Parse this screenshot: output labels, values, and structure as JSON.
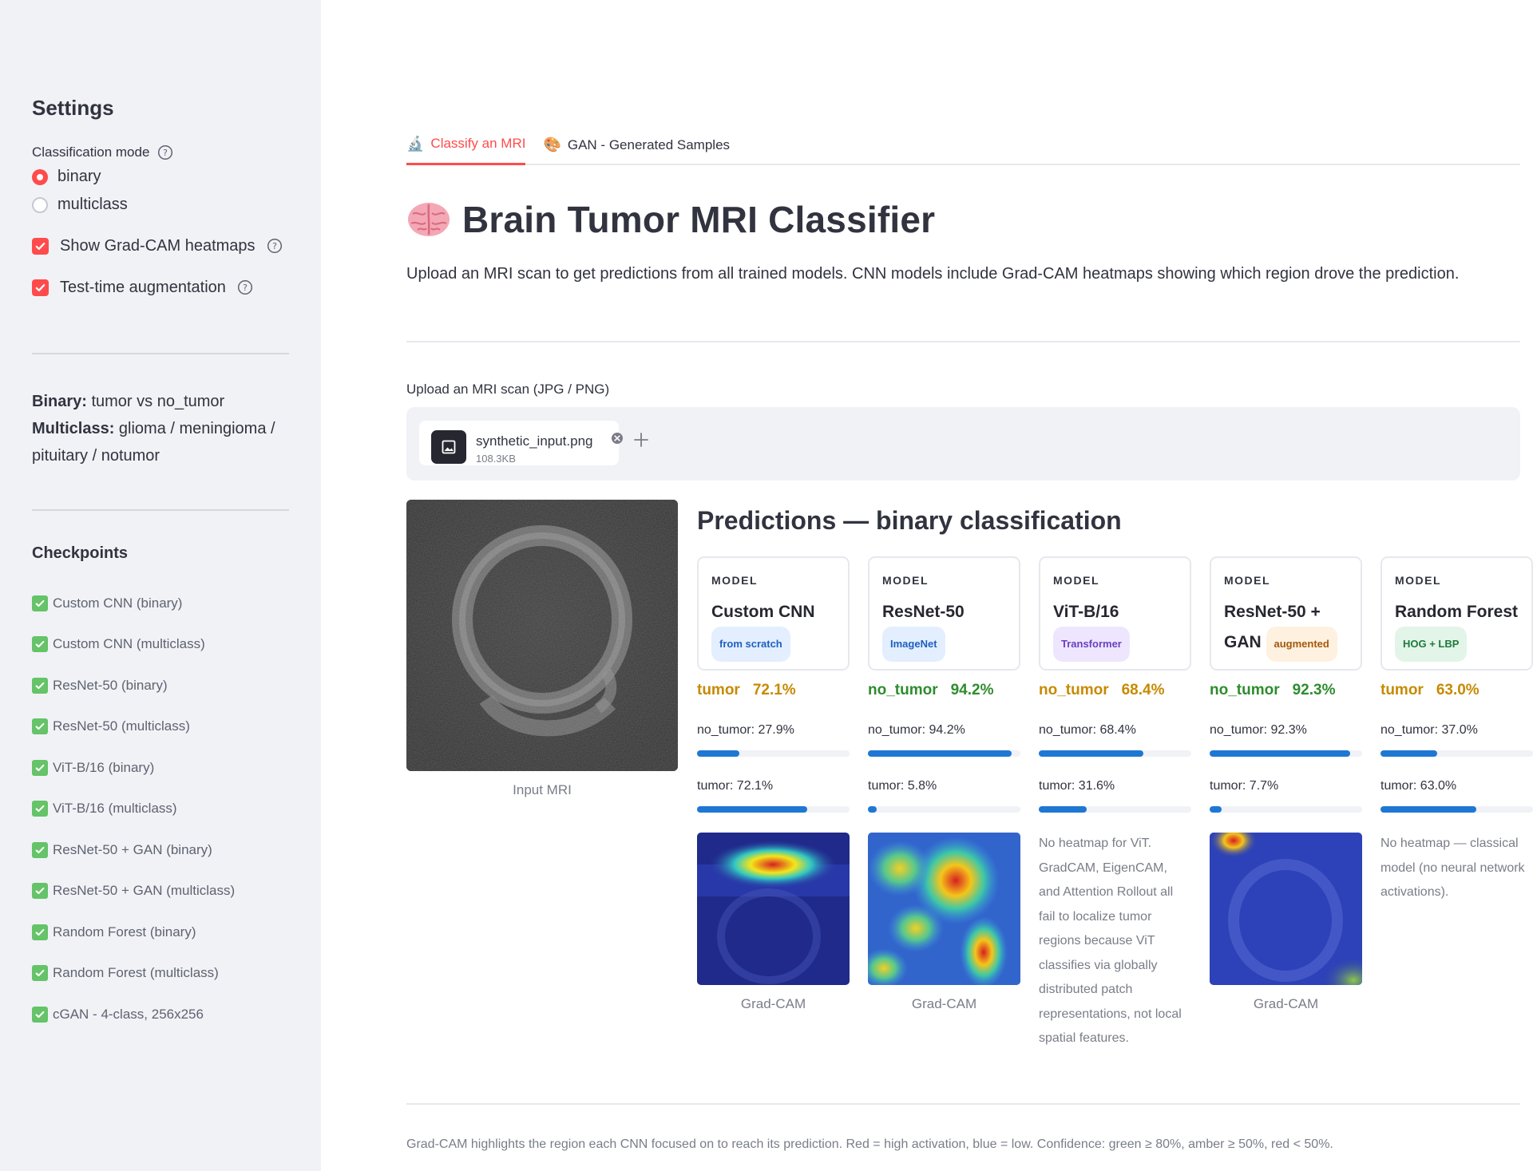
{
  "sidebar": {
    "title": "Settings",
    "classification_mode_label": "Classification mode",
    "modes": [
      {
        "label": "binary",
        "selected": true
      },
      {
        "label": "multiclass",
        "selected": false
      }
    ],
    "gradcam_label": "Show Grad-CAM heatmaps",
    "gradcam_checked": true,
    "tta_label": "Test-time augmentation",
    "tta_checked": true,
    "desc": {
      "binary_key": "Binary:",
      "binary_val": " tumor vs no_tumor",
      "multi_key": "Multiclass:",
      "multi_val": " glioma / meningioma / pituitary / notumor"
    },
    "checkpoints_title": "Checkpoints",
    "checkpoints": [
      "Custom CNN (binary)",
      "Custom CNN (multiclass)",
      "ResNet-50 (binary)",
      "ResNet-50 (multiclass)",
      "ViT-B/16 (binary)",
      "ViT-B/16 (multiclass)",
      "ResNet-50 + GAN (binary)",
      "ResNet-50 + GAN (multiclass)",
      "Random Forest (binary)",
      "Random Forest (multiclass)",
      "cGAN - 4-class, 256x256"
    ]
  },
  "tabs": [
    {
      "icon": "🔬",
      "label": "Classify an MRI",
      "active": true
    },
    {
      "icon": "🎨",
      "label": "GAN - Generated Samples",
      "active": false
    }
  ],
  "header": {
    "title": "Brain Tumor MRI Classifier",
    "lead": "Upload an MRI scan to get predictions from all trained models. CNN models include Grad-CAM heatmaps showing which region drove the prediction."
  },
  "uploader": {
    "label": "Upload an MRI scan (JPG / PNG)",
    "file_name": "synthetic_input.png",
    "file_size": "108.3KB"
  },
  "input_caption": "Input MRI",
  "predictions_title": "Predictions — binary classification",
  "colors": {
    "accent": "#ff4b4b",
    "bar": "#1f77d4",
    "amber": "#c78a00",
    "green": "#2e8c2e"
  },
  "models": [
    {
      "model_label": "MODEL",
      "name": "Custom CNN",
      "tag": "from scratch",
      "tag_style": "blue",
      "pred": "tumor",
      "conf": "72.1%",
      "conf_color": "amber",
      "p_no_tumor_label": "no_tumor: 27.9%",
      "p_no_tumor": 0.279,
      "p_tumor_label": "tumor: 72.1%",
      "p_tumor": 0.721,
      "heatmap": "gradcam-top",
      "caption": "Grad-CAM",
      "note": ""
    },
    {
      "model_label": "MODEL",
      "name": "ResNet-50",
      "tag": "ImageNet",
      "tag_style": "blue",
      "pred": "no_tumor",
      "conf": "94.2%",
      "conf_color": "green",
      "p_no_tumor_label": "no_tumor: 94.2%",
      "p_no_tumor": 0.942,
      "p_tumor_label": "tumor: 5.8%",
      "p_tumor": 0.058,
      "heatmap": "gradcam-scattered",
      "caption": "Grad-CAM",
      "note": ""
    },
    {
      "model_label": "MODEL",
      "name": "ViT-B/16",
      "tag": "Transformer",
      "tag_style": "purple",
      "pred": "no_tumor",
      "conf": "68.4%",
      "conf_color": "amber",
      "p_no_tumor_label": "no_tumor: 68.4%",
      "p_no_tumor": 0.684,
      "p_tumor_label": "tumor: 31.6%",
      "p_tumor": 0.316,
      "heatmap": "",
      "caption": "",
      "note": "No heatmap for ViT. GradCAM, EigenCAM, and Attention Rollout all fail to localize tumor regions because ViT classifies via globally distributed patch representations, not local spatial features."
    },
    {
      "model_label": "MODEL",
      "name": "ResNet-50 + GAN",
      "tag": "augmented",
      "tag_style": "orange",
      "pred": "no_tumor",
      "conf": "92.3%",
      "conf_color": "green",
      "p_no_tumor_label": "no_tumor: 92.3%",
      "p_no_tumor": 0.923,
      "p_tumor_label": "tumor: 7.7%",
      "p_tumor": 0.077,
      "heatmap": "gradcam-cool",
      "caption": "Grad-CAM",
      "note": ""
    },
    {
      "model_label": "MODEL",
      "name": "Random Forest",
      "tag": "HOG + LBP",
      "tag_style": "green",
      "pred": "tumor",
      "conf": "63.0%",
      "conf_color": "amber",
      "p_no_tumor_label": "no_tumor: 37.0%",
      "p_no_tumor": 0.37,
      "p_tumor_label": "tumor: 63.0%",
      "p_tumor": 0.63,
      "heatmap": "",
      "caption": "",
      "note": "No heatmap — classical model (no neural network activations)."
    }
  ],
  "footnote": "Grad-CAM highlights the region each CNN focused on to reach its prediction. Red = high activation, blue = low. Confidence: green ≥ 80%, amber ≥ 50%, red < 50%."
}
